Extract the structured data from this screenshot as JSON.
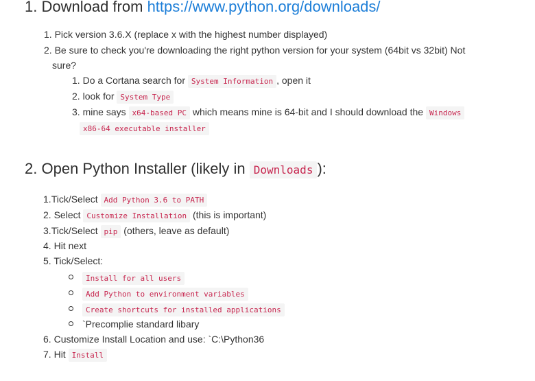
{
  "section1": {
    "heading_num": "1.",
    "heading_text": "Download from",
    "heading_link": "https://www.python.org/downloads/",
    "items": [
      {
        "num": "1.",
        "text": "Pick version 3.6.X (replace x with the highest number displayed)"
      },
      {
        "num": "2.",
        "text_line1": "Be sure to check you're downloading the right python version for your system (64bit vs 32bit) Not",
        "text_line2": "sure?"
      }
    ],
    "subitems": [
      {
        "num": "1.",
        "pre": "Do a Cortana search for",
        "code": "System Information",
        "post": ", open it"
      },
      {
        "num": "2.",
        "pre": "look for",
        "code": "System Type"
      },
      {
        "num": "3.",
        "pre": "mine says",
        "code": "x64-based PC",
        "mid": "which means mine is 64-bit and I should download the",
        "code2": "Windows",
        "code3": "x86-64 executable installer"
      }
    ]
  },
  "section2": {
    "heading_num": "2.",
    "heading_text": "Open Python Installer (likely in",
    "heading_code": "Downloads",
    "heading_end": "):",
    "items": [
      {
        "num": "1.",
        "pre": "Tick/Select",
        "code": "Add Python 3.6 to PATH"
      },
      {
        "num": "2.",
        "pre": "Select",
        "code": "Customize Installation",
        "post": "(this is important)"
      },
      {
        "num": "3.",
        "pre": "Tick/Select",
        "code": "pip",
        "post": "(others, leave as default)"
      },
      {
        "num": "4.",
        "pre": "Hit next"
      },
      {
        "num": "5.",
        "pre": "Tick/Select:"
      }
    ],
    "bullets": [
      {
        "code": "Install for all users"
      },
      {
        "code": "Add Python to environment variables"
      },
      {
        "code": "Create shortcuts for installed applications"
      },
      {
        "text": "`Precomplie standard libary"
      }
    ],
    "tail": [
      {
        "num": "6.",
        "pre": "Customize Install Location and use: `C:\\Python36"
      },
      {
        "num": "7.",
        "pre": "Hit",
        "code": "Install"
      }
    ]
  }
}
